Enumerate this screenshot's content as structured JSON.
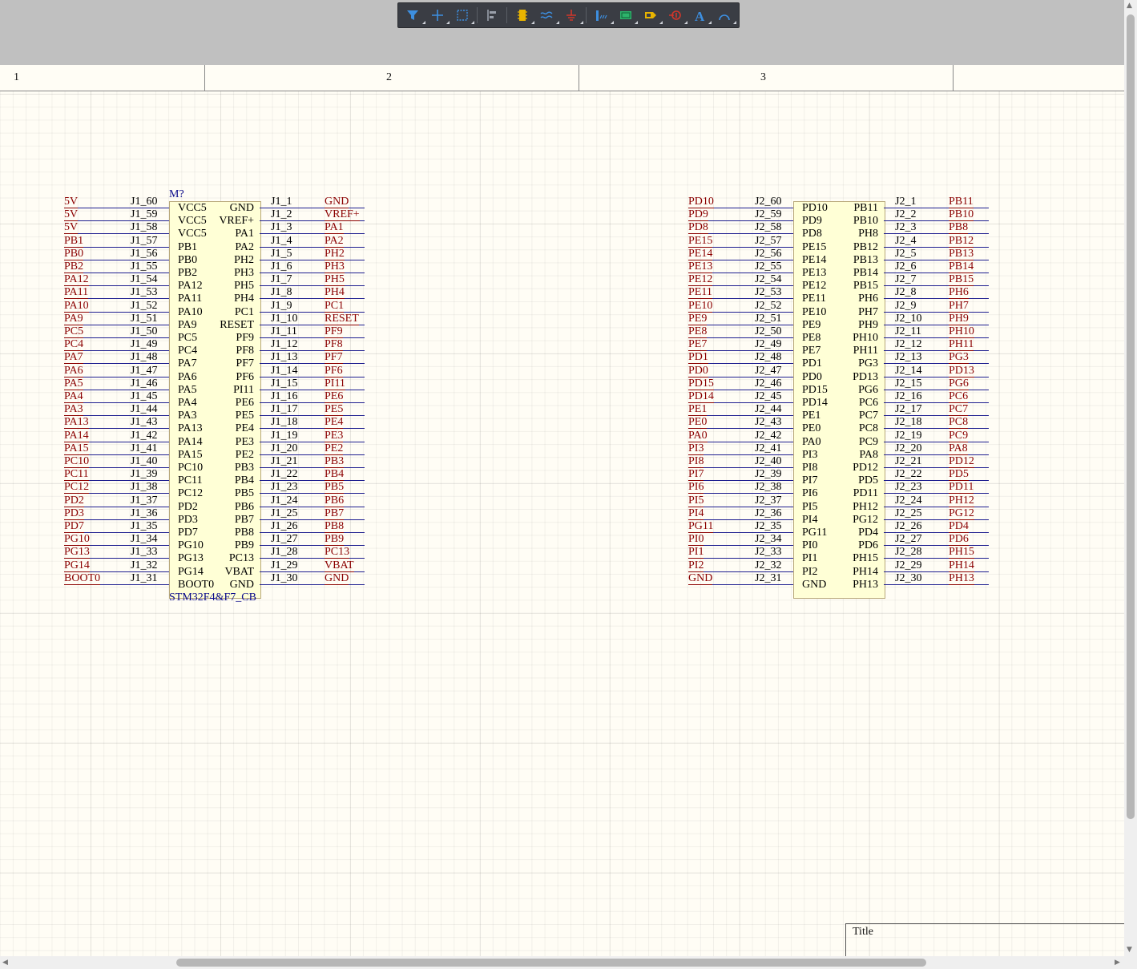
{
  "toolbar": {
    "tools": [
      {
        "name": "filter-icon",
        "color": "#3d8fe0"
      },
      {
        "name": "cross-probe-icon",
        "color": "#3d8fe0"
      },
      {
        "name": "select-rectangle-icon",
        "color": "#3d8fe0"
      },
      {
        "name": "align-icon",
        "color": "#9aa0aa"
      },
      {
        "name": "place-component-icon",
        "color": "#e8b400"
      },
      {
        "name": "wire-icon",
        "color": "#3d8fe0"
      },
      {
        "name": "power-port-icon",
        "color": "#d0372b"
      },
      {
        "name": "bus-icon",
        "color": "#3d8fe0"
      },
      {
        "name": "sheet-symbol-icon",
        "color": "#2db36b"
      },
      {
        "name": "port-icon",
        "color": "#e8b400"
      },
      {
        "name": "no-erc-icon",
        "color": "#d0372b"
      },
      {
        "name": "text-icon",
        "color": "#3d8fe0"
      },
      {
        "name": "arc-icon",
        "color": "#3d8fe0"
      }
    ]
  },
  "zones": [
    "1",
    "2",
    "3",
    ""
  ],
  "colors": {
    "net": "#8b0000",
    "wire": "#1d1d8f",
    "body": "#ffffd6",
    "designator": "#0a0a8a"
  },
  "m1": {
    "designator": "M?",
    "comment": "STM32F4&F7_CB",
    "left": [
      {
        "net": "5V",
        "pin": "J1_60",
        "name": "VCC5"
      },
      {
        "net": "5V",
        "pin": "J1_59",
        "name": "VCC5"
      },
      {
        "net": "5V",
        "pin": "J1_58",
        "name": "VCC5"
      },
      {
        "net": "PB1",
        "pin": "J1_57",
        "name": "PB1"
      },
      {
        "net": "PB0",
        "pin": "J1_56",
        "name": "PB0"
      },
      {
        "net": "PB2",
        "pin": "J1_55",
        "name": "PB2"
      },
      {
        "net": "PA12",
        "pin": "J1_54",
        "name": "PA12"
      },
      {
        "net": "PA11",
        "pin": "J1_53",
        "name": "PA11"
      },
      {
        "net": "PA10",
        "pin": "J1_52",
        "name": "PA10"
      },
      {
        "net": "PA9",
        "pin": "J1_51",
        "name": "PA9"
      },
      {
        "net": "PC5",
        "pin": "J1_50",
        "name": "PC5"
      },
      {
        "net": "PC4",
        "pin": "J1_49",
        "name": "PC4"
      },
      {
        "net": "PA7",
        "pin": "J1_48",
        "name": "PA7"
      },
      {
        "net": "PA6",
        "pin": "J1_47",
        "name": "PA6"
      },
      {
        "net": "PA5",
        "pin": "J1_46",
        "name": "PA5"
      },
      {
        "net": "PA4",
        "pin": "J1_45",
        "name": "PA4"
      },
      {
        "net": "PA3",
        "pin": "J1_44",
        "name": "PA3"
      },
      {
        "net": "PA13",
        "pin": "J1_43",
        "name": "PA13"
      },
      {
        "net": "PA14",
        "pin": "J1_42",
        "name": "PA14"
      },
      {
        "net": "PA15",
        "pin": "J1_41",
        "name": "PA15"
      },
      {
        "net": "PC10",
        "pin": "J1_40",
        "name": "PC10"
      },
      {
        "net": "PC11",
        "pin": "J1_39",
        "name": "PC11"
      },
      {
        "net": "PC12",
        "pin": "J1_38",
        "name": "PC12"
      },
      {
        "net": "PD2",
        "pin": "J1_37",
        "name": "PD2"
      },
      {
        "net": "PD3",
        "pin": "J1_36",
        "name": "PD3"
      },
      {
        "net": "PD7",
        "pin": "J1_35",
        "name": "PD7"
      },
      {
        "net": "PG10",
        "pin": "J1_34",
        "name": "PG10"
      },
      {
        "net": "PG13",
        "pin": "J1_33",
        "name": "PG13"
      },
      {
        "net": "PG14",
        "pin": "J1_32",
        "name": "PG14"
      },
      {
        "net": "BOOT0",
        "pin": "J1_31",
        "name": "BOOT0"
      }
    ],
    "right": [
      {
        "net": "GND",
        "pin": "J1_1",
        "name": "GND"
      },
      {
        "net": "VREF+",
        "pin": "J1_2",
        "name": "VREF+"
      },
      {
        "net": "PA1",
        "pin": "J1_3",
        "name": "PA1"
      },
      {
        "net": "PA2",
        "pin": "J1_4",
        "name": "PA2"
      },
      {
        "net": "PH2",
        "pin": "J1_5",
        "name": "PH2"
      },
      {
        "net": "PH3",
        "pin": "J1_6",
        "name": "PH3"
      },
      {
        "net": "PH5",
        "pin": "J1_7",
        "name": "PH5"
      },
      {
        "net": "PH4",
        "pin": "J1_8",
        "name": "PH4"
      },
      {
        "net": "PC1",
        "pin": "J1_9",
        "name": "PC1"
      },
      {
        "net": "RESET",
        "pin": "J1_10",
        "name": "RESET"
      },
      {
        "net": "PF9",
        "pin": "J1_11",
        "name": "PF9"
      },
      {
        "net": "PF8",
        "pin": "J1_12",
        "name": "PF8"
      },
      {
        "net": "PF7",
        "pin": "J1_13",
        "name": "PF7"
      },
      {
        "net": "PF6",
        "pin": "J1_14",
        "name": "PF6"
      },
      {
        "net": "PI11",
        "pin": "J1_15",
        "name": "PI11"
      },
      {
        "net": "PE6",
        "pin": "J1_16",
        "name": "PE6"
      },
      {
        "net": "PE5",
        "pin": "J1_17",
        "name": "PE5"
      },
      {
        "net": "PE4",
        "pin": "J1_18",
        "name": "PE4"
      },
      {
        "net": "PE3",
        "pin": "J1_19",
        "name": "PE3"
      },
      {
        "net": "PE2",
        "pin": "J1_20",
        "name": "PE2"
      },
      {
        "net": "PB3",
        "pin": "J1_21",
        "name": "PB3"
      },
      {
        "net": "PB4",
        "pin": "J1_22",
        "name": "PB4"
      },
      {
        "net": "PB5",
        "pin": "J1_23",
        "name": "PB5"
      },
      {
        "net": "PB6",
        "pin": "J1_24",
        "name": "PB6"
      },
      {
        "net": "PB7",
        "pin": "J1_25",
        "name": "PB7"
      },
      {
        "net": "PB8",
        "pin": "J1_26",
        "name": "PB8"
      },
      {
        "net": "PB9",
        "pin": "J1_27",
        "name": "PB9"
      },
      {
        "net": "PC13",
        "pin": "J1_28",
        "name": "PC13"
      },
      {
        "net": "VBAT",
        "pin": "J1_29",
        "name": "VBAT"
      },
      {
        "net": "GND",
        "pin": "J1_30",
        "name": "GND"
      }
    ]
  },
  "m2": {
    "left": [
      {
        "net": "PD10",
        "pin": "J2_60",
        "name": "PD10"
      },
      {
        "net": "PD9",
        "pin": "J2_59",
        "name": "PD9"
      },
      {
        "net": "PD8",
        "pin": "J2_58",
        "name": "PD8"
      },
      {
        "net": "PE15",
        "pin": "J2_57",
        "name": "PE15"
      },
      {
        "net": "PE14",
        "pin": "J2_56",
        "name": "PE14"
      },
      {
        "net": "PE13",
        "pin": "J2_55",
        "name": "PE13"
      },
      {
        "net": "PE12",
        "pin": "J2_54",
        "name": "PE12"
      },
      {
        "net": "PE11",
        "pin": "J2_53",
        "name": "PE11"
      },
      {
        "net": "PE10",
        "pin": "J2_52",
        "name": "PE10"
      },
      {
        "net": "PE9",
        "pin": "J2_51",
        "name": "PE9"
      },
      {
        "net": "PE8",
        "pin": "J2_50",
        "name": "PE8"
      },
      {
        "net": "PE7",
        "pin": "J2_49",
        "name": "PE7"
      },
      {
        "net": "PD1",
        "pin": "J2_48",
        "name": "PD1"
      },
      {
        "net": "PD0",
        "pin": "J2_47",
        "name": "PD0"
      },
      {
        "net": "PD15",
        "pin": "J2_46",
        "name": "PD15"
      },
      {
        "net": "PD14",
        "pin": "J2_45",
        "name": "PD14"
      },
      {
        "net": "PE1",
        "pin": "J2_44",
        "name": "PE1"
      },
      {
        "net": "PE0",
        "pin": "J2_43",
        "name": "PE0"
      },
      {
        "net": "PA0",
        "pin": "J2_42",
        "name": "PA0"
      },
      {
        "net": "PI3",
        "pin": "J2_41",
        "name": "PI3"
      },
      {
        "net": "PI8",
        "pin": "J2_40",
        "name": "PI8"
      },
      {
        "net": "PI7",
        "pin": "J2_39",
        "name": "PI7"
      },
      {
        "net": "PI6",
        "pin": "J2_38",
        "name": "PI6"
      },
      {
        "net": "PI5",
        "pin": "J2_37",
        "name": "PI5"
      },
      {
        "net": "PI4",
        "pin": "J2_36",
        "name": "PI4"
      },
      {
        "net": "PG11",
        "pin": "J2_35",
        "name": "PG11"
      },
      {
        "net": "PI0",
        "pin": "J2_34",
        "name": "PI0"
      },
      {
        "net": "PI1",
        "pin": "J2_33",
        "name": "PI1"
      },
      {
        "net": "PI2",
        "pin": "J2_32",
        "name": "PI2"
      },
      {
        "net": "GND",
        "pin": "J2_31",
        "name": "GND"
      }
    ],
    "right": [
      {
        "net": "PB11",
        "pin": "J2_1",
        "name": "PB11"
      },
      {
        "net": "PB10",
        "pin": "J2_2",
        "name": "PB10"
      },
      {
        "net": "PB8",
        "pin": "J2_3",
        "name": "PH8"
      },
      {
        "net": "PB12",
        "pin": "J2_4",
        "name": "PB12"
      },
      {
        "net": "PB13",
        "pin": "J2_5",
        "name": "PB13"
      },
      {
        "net": "PB14",
        "pin": "J2_6",
        "name": "PB14"
      },
      {
        "net": "PB15",
        "pin": "J2_7",
        "name": "PB15"
      },
      {
        "net": "PH6",
        "pin": "J2_8",
        "name": "PH6"
      },
      {
        "net": "PH7",
        "pin": "J2_9",
        "name": "PH7"
      },
      {
        "net": "PH9",
        "pin": "J2_10",
        "name": "PH9"
      },
      {
        "net": "PH10",
        "pin": "J2_11",
        "name": "PH10"
      },
      {
        "net": "PH11",
        "pin": "J2_12",
        "name": "PH11"
      },
      {
        "net": "PG3",
        "pin": "J2_13",
        "name": "PG3"
      },
      {
        "net": "PD13",
        "pin": "J2_14",
        "name": "PD13"
      },
      {
        "net": "PG6",
        "pin": "J2_15",
        "name": "PG6"
      },
      {
        "net": "PC6",
        "pin": "J2_16",
        "name": "PC6"
      },
      {
        "net": "PC7",
        "pin": "J2_17",
        "name": "PC7"
      },
      {
        "net": "PC8",
        "pin": "J2_18",
        "name": "PC8"
      },
      {
        "net": "PC9",
        "pin": "J2_19",
        "name": "PC9"
      },
      {
        "net": "PA8",
        "pin": "J2_20",
        "name": "PA8"
      },
      {
        "net": "PD12",
        "pin": "J2_21",
        "name": "PD12"
      },
      {
        "net": "PD5",
        "pin": "J2_22",
        "name": "PD5"
      },
      {
        "net": "PD11",
        "pin": "J2_23",
        "name": "PD11"
      },
      {
        "net": "PH12",
        "pin": "J2_24",
        "name": "PH12"
      },
      {
        "net": "PG12",
        "pin": "J2_25",
        "name": "PG12"
      },
      {
        "net": "PD4",
        "pin": "J2_26",
        "name": "PD4"
      },
      {
        "net": "PD6",
        "pin": "J2_27",
        "name": "PD6"
      },
      {
        "net": "PH15",
        "pin": "J2_28",
        "name": "PH15"
      },
      {
        "net": "PH14",
        "pin": "J2_29",
        "name": "PH14"
      },
      {
        "net": "PH13",
        "pin": "J2_30",
        "name": "PH13"
      }
    ]
  },
  "title_block": {
    "title_label": "Title"
  },
  "scroll": {
    "left_arrow": "◀",
    "right_arrow": "▶",
    "up_arrow": "▲",
    "down_arrow": "▼"
  }
}
